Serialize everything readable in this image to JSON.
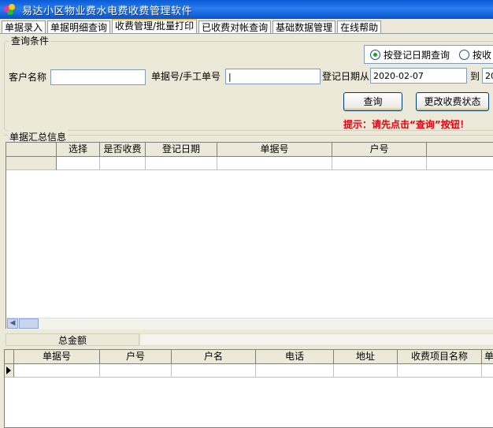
{
  "window": {
    "title": "易达小区物业费水电费收费管理软件"
  },
  "tabs": [
    {
      "label": "单据录入"
    },
    {
      "label": "单据明细查询"
    },
    {
      "label": "收费管理/批量打印"
    },
    {
      "label": "已收费对帐查询"
    },
    {
      "label": "基础数据管理"
    },
    {
      "label": "在线帮助"
    }
  ],
  "query": {
    "legend": "查询条件",
    "radio_by_date": "按登记日期查询",
    "radio_by_fee": "按收",
    "customer_label": "客户名称",
    "customer_value": "",
    "doc_label": "单据号/手工单号",
    "doc_value": "|",
    "date_from_label": "登记日期从",
    "date_from_value": "2020-02-07",
    "date_to_label": "到",
    "date_to_value": "20",
    "query_button": "查询",
    "change_status_button": "更改收费状态",
    "hint": "提示：请先点击“查询”按钮！"
  },
  "summary": {
    "legend": "单据汇总信息",
    "columns": [
      "选择",
      "是否收费",
      "登记日期",
      "单据号",
      "户号",
      "户名"
    ],
    "total_label": "总金额"
  },
  "detail": {
    "columns": [
      "单据号",
      "户号",
      "户名",
      "电话",
      "地址",
      "收费项目名称",
      "单"
    ]
  }
}
